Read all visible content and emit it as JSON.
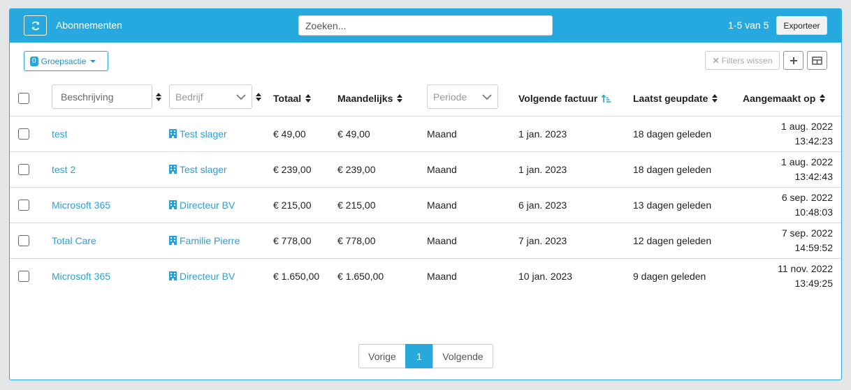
{
  "header": {
    "title": "Abonnementen",
    "search_placeholder": "Zoeken...",
    "range": "1-5 van 5",
    "export_label": "Exporteer"
  },
  "toolbar": {
    "group_count": "0",
    "group_label": "Groepsactie",
    "filters_clear_label": "Filters wissen"
  },
  "columns": {
    "description_placeholder": "Beschrijving",
    "company_placeholder": "Bedrijf",
    "total": "Totaal",
    "monthly": "Maandelijks",
    "period_placeholder": "Periode",
    "next_invoice": "Volgende factuur",
    "last_updated": "Laatst geupdate",
    "created_at": "Aangemaakt op"
  },
  "rows": [
    {
      "description": "test",
      "company": "Test slager",
      "total": "€ 49,00",
      "monthly": "€ 49,00",
      "period": "Maand",
      "next_invoice": "1 jan. 2023",
      "updated": "18 dagen geleden",
      "created_date": "1 aug. 2022",
      "created_time": "13:42:23"
    },
    {
      "description": "test 2",
      "company": "Test slager",
      "total": "€ 239,00",
      "monthly": "€ 239,00",
      "period": "Maand",
      "next_invoice": "1 jan. 2023",
      "updated": "18 dagen geleden",
      "created_date": "1 aug. 2022",
      "created_time": "13:42:43"
    },
    {
      "description": "Microsoft 365",
      "company": "Directeur BV",
      "total": "€ 215,00",
      "monthly": "€ 215,00",
      "period": "Maand",
      "next_invoice": "6 jan. 2023",
      "updated": "13 dagen geleden",
      "created_date": "6 sep. 2022",
      "created_time": "10:48:03"
    },
    {
      "description": "Total Care",
      "company": "Familie Pierre",
      "total": "€ 778,00",
      "monthly": "€ 778,00",
      "period": "Maand",
      "next_invoice": "7 jan. 2023",
      "updated": "12 dagen geleden",
      "created_date": "7 sep. 2022",
      "created_time": "14:59:52"
    },
    {
      "description": "Microsoft 365",
      "company": "Directeur BV",
      "total": "€ 1.650,00",
      "monthly": "€ 1.650,00",
      "period": "Maand",
      "next_invoice": "10 jan. 2023",
      "updated": "9 dagen geleden",
      "created_date": "11 nov. 2022",
      "created_time": "13:49:25"
    }
  ],
  "pagination": {
    "prev": "Vorige",
    "current": "1",
    "next": "Volgende"
  },
  "colors": {
    "accent": "#26a9df",
    "link": "#2b9fd8"
  }
}
